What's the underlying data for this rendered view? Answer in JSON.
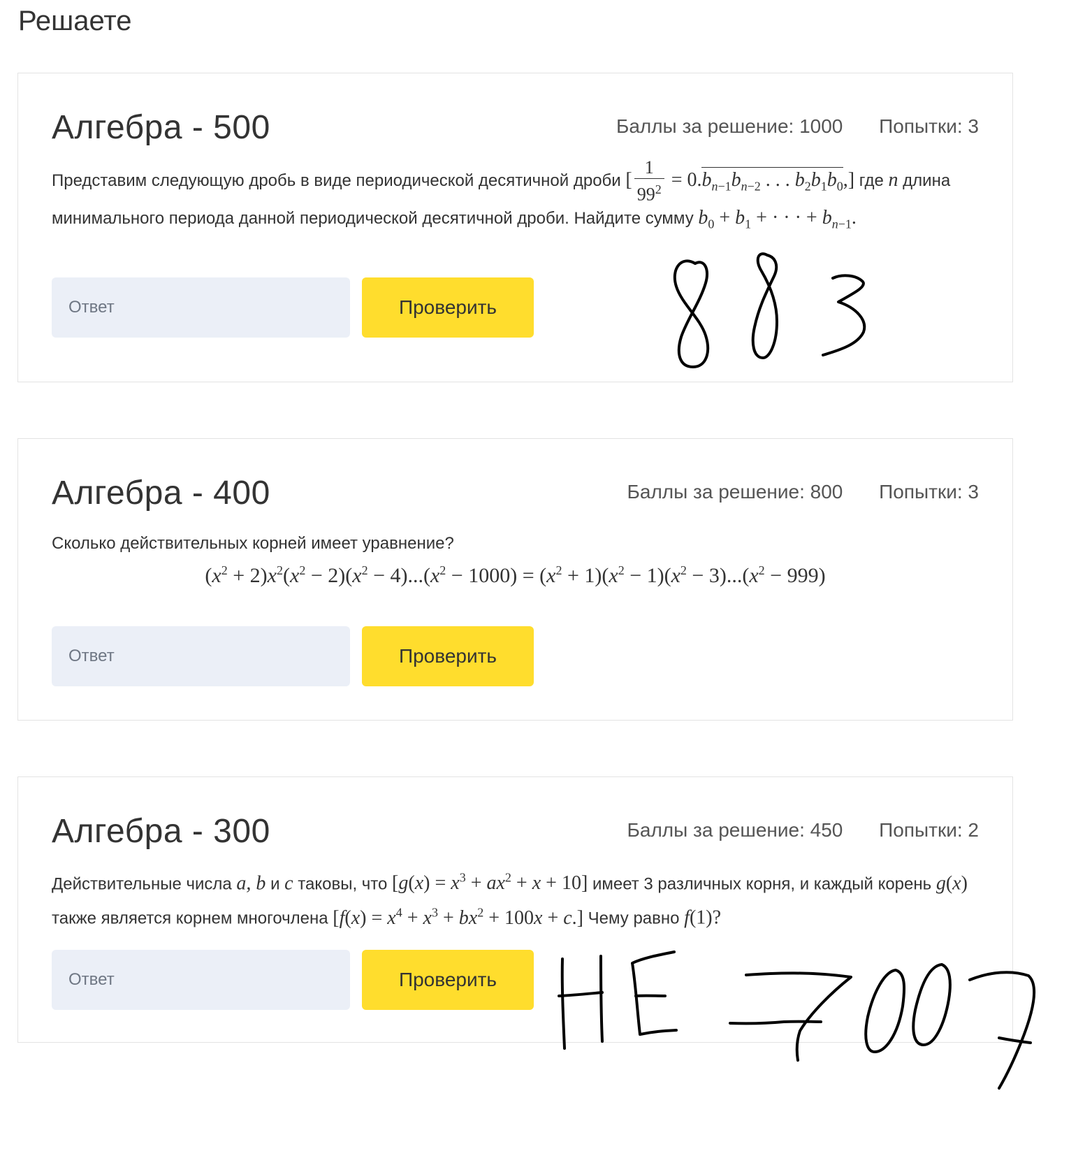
{
  "page": {
    "heading": "Решаете"
  },
  "labels": {
    "points": "Баллы за решение:",
    "attempts": "Попытки:"
  },
  "tasks": [
    {
      "title": "Алгебра - 500",
      "points": "1000",
      "attempts": "3",
      "text": {
        "intro": "Представим следующую дробь в виде периодической десятичной дроби",
        "where": "где",
        "length": "длина минимального периода данной периодической десятичной дроби. Найдите сумму"
      },
      "answer_placeholder": "Ответ",
      "button": "Проверить"
    },
    {
      "title": "Алгебра - 400",
      "points": "800",
      "attempts": "3",
      "text": {
        "question": "Сколько действительных корней имеет уравнение?"
      },
      "answer_placeholder": "Ответ",
      "button": "Проверить"
    },
    {
      "title": "Алгебра - 300",
      "points": "450",
      "attempts": "2",
      "text": {
        "p1": "Действительные числа",
        "and": "и",
        "such": "таковы, что",
        "has": "имеет 3 различных корня, и каждый корень",
        "also": "также является корнем многочлена",
        "what": "Чему равно"
      },
      "answer_placeholder": "Ответ",
      "button": "Проверить"
    }
  ],
  "annotations": {
    "note_1": "883",
    "note_2": "НЕ -7007"
  }
}
